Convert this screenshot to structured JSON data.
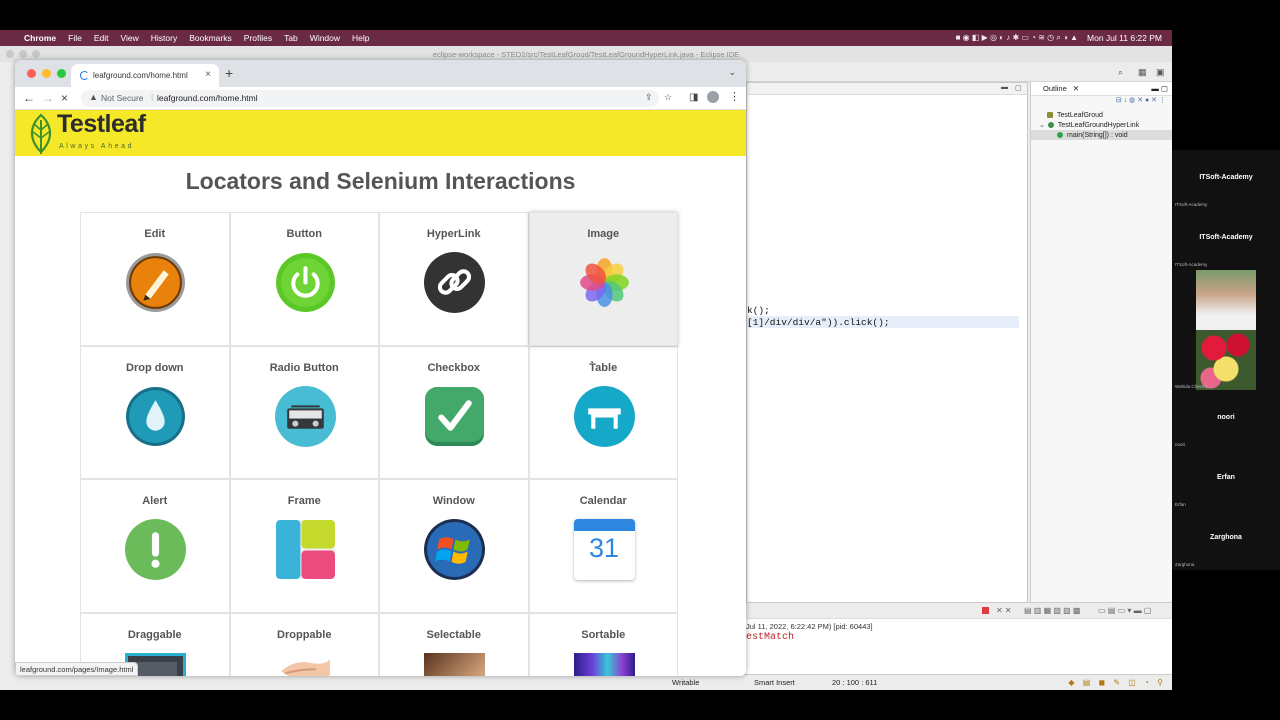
{
  "menubar": {
    "app": "Chrome",
    "items": [
      "File",
      "Edit",
      "View",
      "History",
      "Bookmarks",
      "Profiles",
      "Tab",
      "Window",
      "Help"
    ],
    "datetime": "Mon Jul 11  6:22 PM"
  },
  "eclipse": {
    "title": "eclipse-workspace - STED2/src/TestLeafGroud/TestLeafGroundHyperLink.java - Eclipse IDE",
    "code_line1": "k();",
    "code_line2": "[1]/div/div/a\")).click();",
    "outline_tab": "Outline",
    "outline_items": [
      "TestLeafGroud",
      "TestLeafGroundHyperLink",
      "main(String[]) : void"
    ],
    "console_line1": "Jul 11, 2022, 6:22:42 PM) [pid: 60443]",
    "console_line2": "estMatch",
    "status": {
      "writable": "Writable",
      "insert": "Smart Insert",
      "position": "20 : 100 : 611"
    }
  },
  "browser": {
    "tab_title": "leafground.com/home.html",
    "security": "Not Secure",
    "url": "leafground.com/home.html",
    "status_url": "leafground.com/pages/Image.html"
  },
  "page": {
    "logo_text": "Testleaf",
    "logo_tagline": "Always Ahead",
    "heading": "Locators and Selenium Interactions",
    "tiles": [
      {
        "label": "Edit",
        "icon": "edit-pencil-icon"
      },
      {
        "label": "Button",
        "icon": "power-button-icon"
      },
      {
        "label": "HyperLink",
        "icon": "chain-link-icon"
      },
      {
        "label": "Image",
        "icon": "photos-flower-icon"
      },
      {
        "label": "Drop down",
        "icon": "water-drop-icon"
      },
      {
        "label": "Radio Button",
        "icon": "radio-device-icon"
      },
      {
        "label": "Checkbox",
        "icon": "checkmark-icon"
      },
      {
        "label": "Table",
        "icon": "table-icon"
      },
      {
        "label": "Alert",
        "icon": "alert-exclamation-icon"
      },
      {
        "label": "Frame",
        "icon": "frame-tiles-icon"
      },
      {
        "label": "Window",
        "icon": "windows-logo-icon"
      },
      {
        "label": "Calendar",
        "icon": "calendar-icon"
      },
      {
        "label": "Draggable",
        "icon": "draggable-icon"
      },
      {
        "label": "Droppable",
        "icon": "droppable-icon"
      },
      {
        "label": "Selectable",
        "icon": "selectable-icon"
      },
      {
        "label": "Sortable",
        "icon": "sortable-icon"
      }
    ],
    "calendar_day": "31"
  },
  "zoom": {
    "participants": [
      {
        "name": "ITSoft-Academy",
        "small": "ITSoft-Academy"
      },
      {
        "name": "ITSoft-Academy",
        "small": "ITSoft-Academy"
      },
      {
        "name": "",
        "small": "Wahida Chechty"
      },
      {
        "name": "noori",
        "small": "noori"
      },
      {
        "name": "Erfan",
        "small": "Erfan"
      },
      {
        "name": "Zarghona",
        "small": "Zarghona"
      }
    ]
  },
  "colors": {
    "menubar": "#6a2a43",
    "banner": "#f5e829",
    "heading": "#555555"
  }
}
